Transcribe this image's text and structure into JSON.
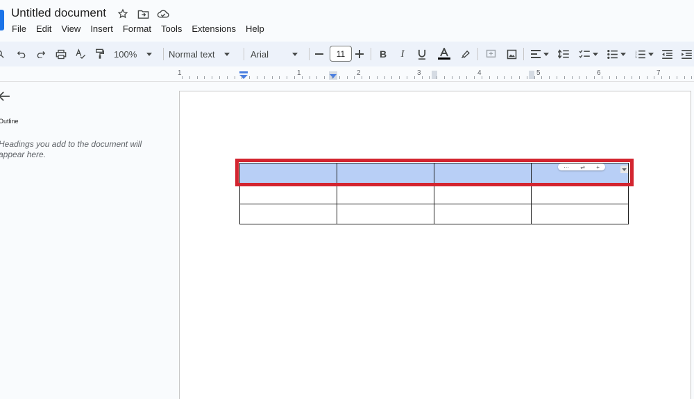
{
  "document": {
    "title": "Untitled document"
  },
  "menu": [
    "File",
    "Edit",
    "View",
    "Insert",
    "Format",
    "Tools",
    "Extensions",
    "Help"
  ],
  "toolbar": {
    "zoom": "100%",
    "style": "Normal text",
    "font": "Arial",
    "font_size": "11"
  },
  "ruler": {
    "numbers": [
      "1",
      "1",
      "2",
      "3",
      "4",
      "5",
      "6",
      "7"
    ]
  },
  "sidebar": {
    "label": "Outline",
    "hint": "Headings you add to the document will appear here."
  },
  "table": {
    "rows": 3,
    "cols": 4,
    "selected_row": 1
  },
  "colors": {
    "accent": "#1a73e8",
    "selection": "#b8cff6",
    "highlight": "#d32530",
    "toolbar_bg": "#edf2fa"
  }
}
